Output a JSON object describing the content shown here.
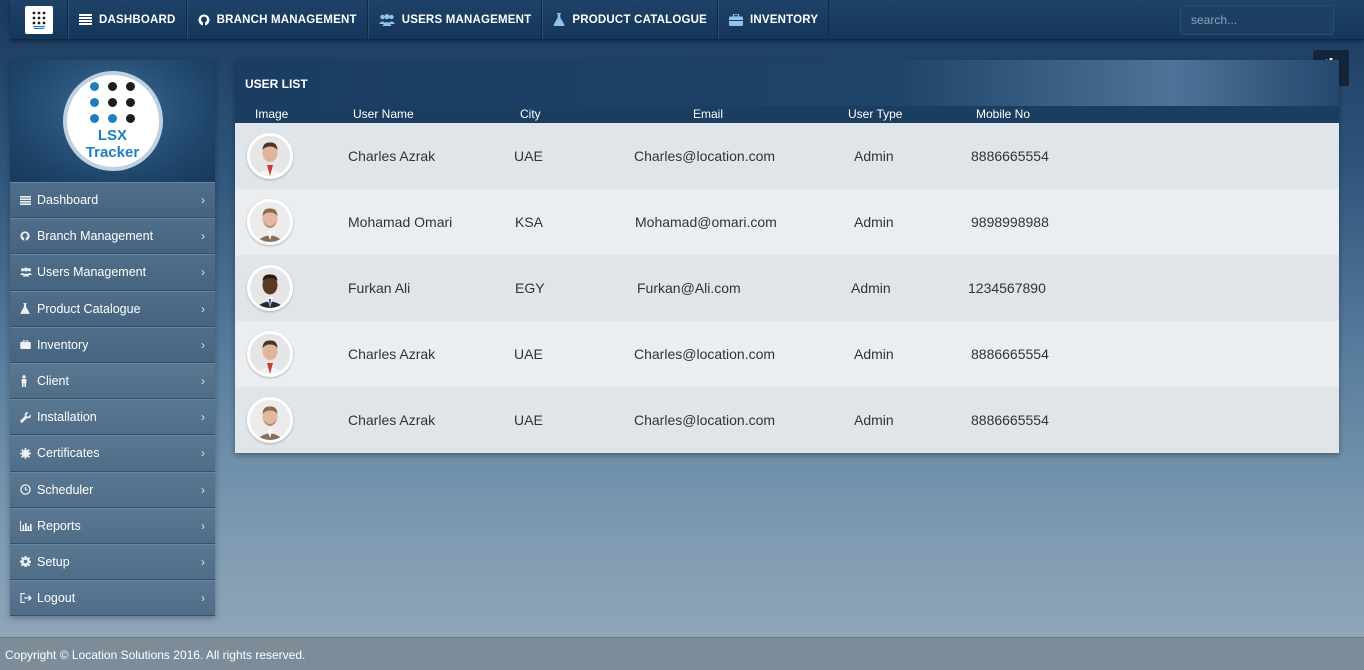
{
  "topnav": {
    "items": [
      {
        "label": "DASHBOARD",
        "icon": "dashboard-icon"
      },
      {
        "label": "BRANCH MANAGEMENT",
        "icon": "github-icon"
      },
      {
        "label": "USERS MANAGEMENT",
        "icon": "users-icon"
      },
      {
        "label": "PRODUCT CATALOGUE",
        "icon": "flask-icon"
      },
      {
        "label": "INVENTORY",
        "icon": "briefcase-icon"
      }
    ],
    "search_placeholder": "search..."
  },
  "logo": {
    "line1": "LSX",
    "line2": "Tracker"
  },
  "sidebar": {
    "items": [
      {
        "label": "Dashboard",
        "icon": "dashboard-icon"
      },
      {
        "label": "Branch Management",
        "icon": "github-icon"
      },
      {
        "label": "Users Management",
        "icon": "users-icon"
      },
      {
        "label": "Product Catalogue",
        "icon": "flask-icon"
      },
      {
        "label": "Inventory",
        "icon": "briefcase-icon"
      },
      {
        "label": "Client",
        "icon": "person-icon"
      },
      {
        "label": "Installation",
        "icon": "wrench-icon"
      },
      {
        "label": "Certificates",
        "icon": "certificate-icon"
      },
      {
        "label": "Scheduler",
        "icon": "clock-icon"
      },
      {
        "label": "Reports",
        "icon": "bar-chart-icon"
      },
      {
        "label": "Setup",
        "icon": "gear-icon"
      },
      {
        "label": "Logout",
        "icon": "logout-icon"
      }
    ]
  },
  "panel": {
    "title": "USER LIST",
    "columns": [
      "Image",
      "User Name",
      "City",
      "Email",
      "User Type",
      "Mobile No"
    ],
    "rows": [
      {
        "name": "Charles Azrak",
        "city": "UAE",
        "email": "Charles@location.com",
        "type": "Admin",
        "mobile": "8886665554"
      },
      {
        "name": "Mohamad Omari",
        "city": "KSA",
        "email": "Mohamad@omari.com",
        "type": "Admin",
        "mobile": "9898998988"
      },
      {
        "name": "Furkan Ali",
        "city": "EGY",
        "email": "Furkan@Ali.com",
        "type": "Admin",
        "mobile": "1234567890"
      },
      {
        "name": "Charles Azrak",
        "city": "UAE",
        "email": "Charles@location.com",
        "type": "Admin",
        "mobile": "8886665554"
      },
      {
        "name": "Charles Azrak",
        "city": "UAE",
        "email": "Charles@location.com",
        "type": "Admin",
        "mobile": "8886665554"
      }
    ]
  },
  "footer": {
    "text": "Copyright © Location Solutions 2016. All rights reserved."
  }
}
